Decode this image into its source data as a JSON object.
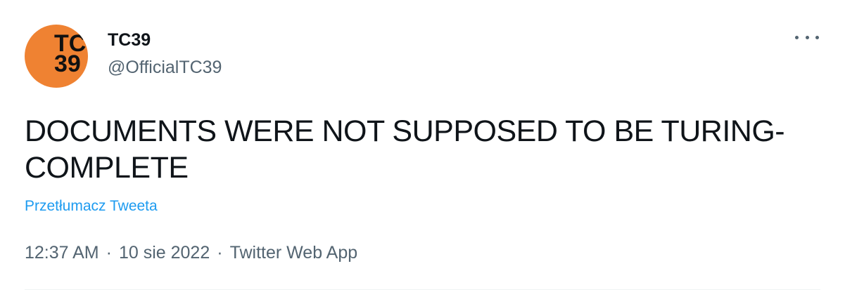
{
  "author": {
    "name": "TC39",
    "handle": "@OfficialTC39",
    "avatar_line1": "TC",
    "avatar_line2": "39",
    "avatar_color": "#ef8232"
  },
  "tweet": {
    "text": "DOCUMENTS WERE NOT SUPPOSED TO BE TURING-COMPLETE",
    "translate_label": "Przetłumacz Tweeta"
  },
  "meta": {
    "time": "12:37 AM",
    "separator": "·",
    "date": "10 sie 2022",
    "source": "Twitter Web App"
  },
  "icons": {
    "more": "more-horizontal-icon"
  },
  "colors": {
    "link": "#1d9bf0",
    "secondary_text": "#536471",
    "primary_text": "#0f1419"
  }
}
